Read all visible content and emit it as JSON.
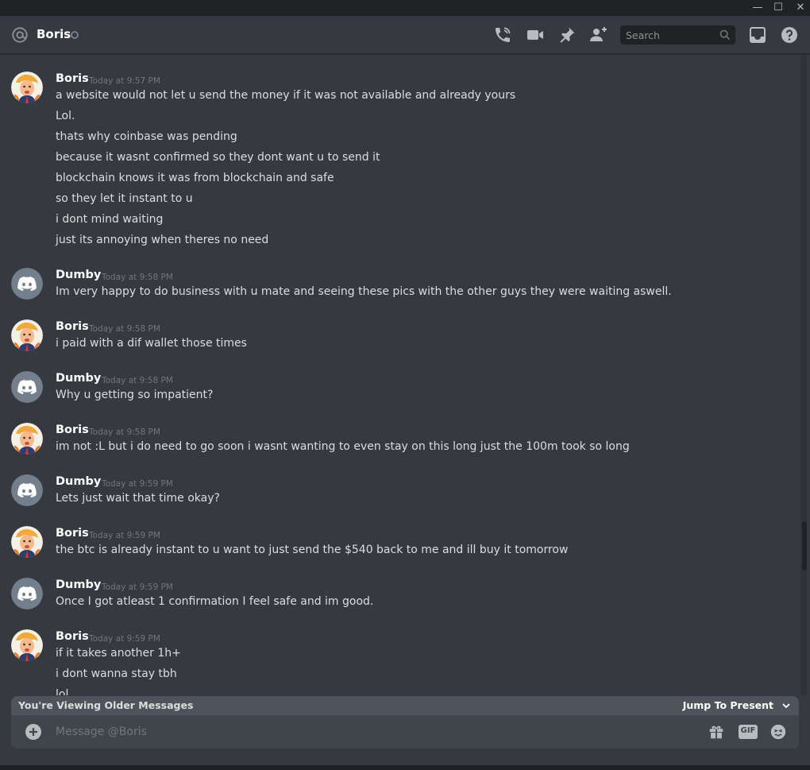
{
  "window": {
    "minimize_glyph": "—",
    "maximize_glyph": "☐",
    "close_glyph": "✕"
  },
  "header": {
    "channel_name": "Boris",
    "icons": [
      "at-icon",
      "start-voice-call-icon",
      "start-video-call-icon",
      "pinned-messages-icon",
      "add-friend-to-dm-icon",
      "inbox-icon",
      "help-icon"
    ],
    "search_placeholder": "Search"
  },
  "messages": [
    {
      "author": "Boris",
      "avatar": "boris-avatar",
      "timestamp": "Today at 9:57 PM",
      "lines": [
        "a website would not let u send the money if it was not available and already yours",
        "Lol.",
        "thats why coinbase was pending",
        "because it wasnt confirmed so they dont want u to send it",
        "blockchain knows it was from blockchain and safe",
        "so they let it instant to u",
        "i dont mind waiting",
        "just its annoying when theres no need"
      ]
    },
    {
      "author": "Dumby",
      "avatar": "discord-default-avatar",
      "timestamp": "Today at 9:58 PM",
      "lines": [
        "Im very happy to do business with u mate and seeing these pics with the other guys they were waiting aswell."
      ]
    },
    {
      "author": "Boris",
      "avatar": "boris-avatar",
      "timestamp": "Today at 9:58 PM",
      "lines": [
        "i paid with a dif wallet those times"
      ]
    },
    {
      "author": "Dumby",
      "avatar": "discord-default-avatar",
      "timestamp": "Today at 9:58 PM",
      "lines": [
        "Why u getting so impatient?"
      ]
    },
    {
      "author": "Boris",
      "avatar": "boris-avatar",
      "timestamp": "Today at 9:58 PM",
      "lines": [
        "im not :L but i do need to go soon i wasnt wanting to even stay on this long just the 100m took so long"
      ]
    },
    {
      "author": "Dumby",
      "avatar": "discord-default-avatar",
      "timestamp": "Today at 9:59 PM",
      "lines": [
        "Lets just wait that time okay?"
      ]
    },
    {
      "author": "Boris",
      "avatar": "boris-avatar",
      "timestamp": "Today at 9:59 PM",
      "lines": [
        "the btc is already instant to u want to just send the $540 back to me and ill buy it tomorrow"
      ]
    },
    {
      "author": "Dumby",
      "avatar": "discord-default-avatar",
      "timestamp": "Today at 9:59 PM",
      "lines": [
        "Once I got atleast 1 confirmation I feel safe and im good."
      ]
    },
    {
      "author": "Boris",
      "avatar": "boris-avatar",
      "timestamp": "Today at 9:59 PM",
      "lines": [
        "if it takes another 1h+",
        "i dont wanna stay tbh",
        "lol"
      ]
    }
  ],
  "older_banner": {
    "text": "You're Viewing Older Messages",
    "jump_label": "Jump To Present"
  },
  "composer": {
    "placeholder": "Message @Boris",
    "gif_label": "GIF",
    "icons": [
      "add-attachment-icon",
      "gift-icon",
      "gif-icon",
      "emoji-icon"
    ]
  },
  "colors": {
    "background": "#36393f",
    "titlebar": "#202225",
    "author": "#ffffff",
    "text": "#dcddde",
    "timestamp": "#72767d",
    "discord_avatar_bg": "#747f8d",
    "composer": "#40444b",
    "banner": "#4f545c"
  }
}
